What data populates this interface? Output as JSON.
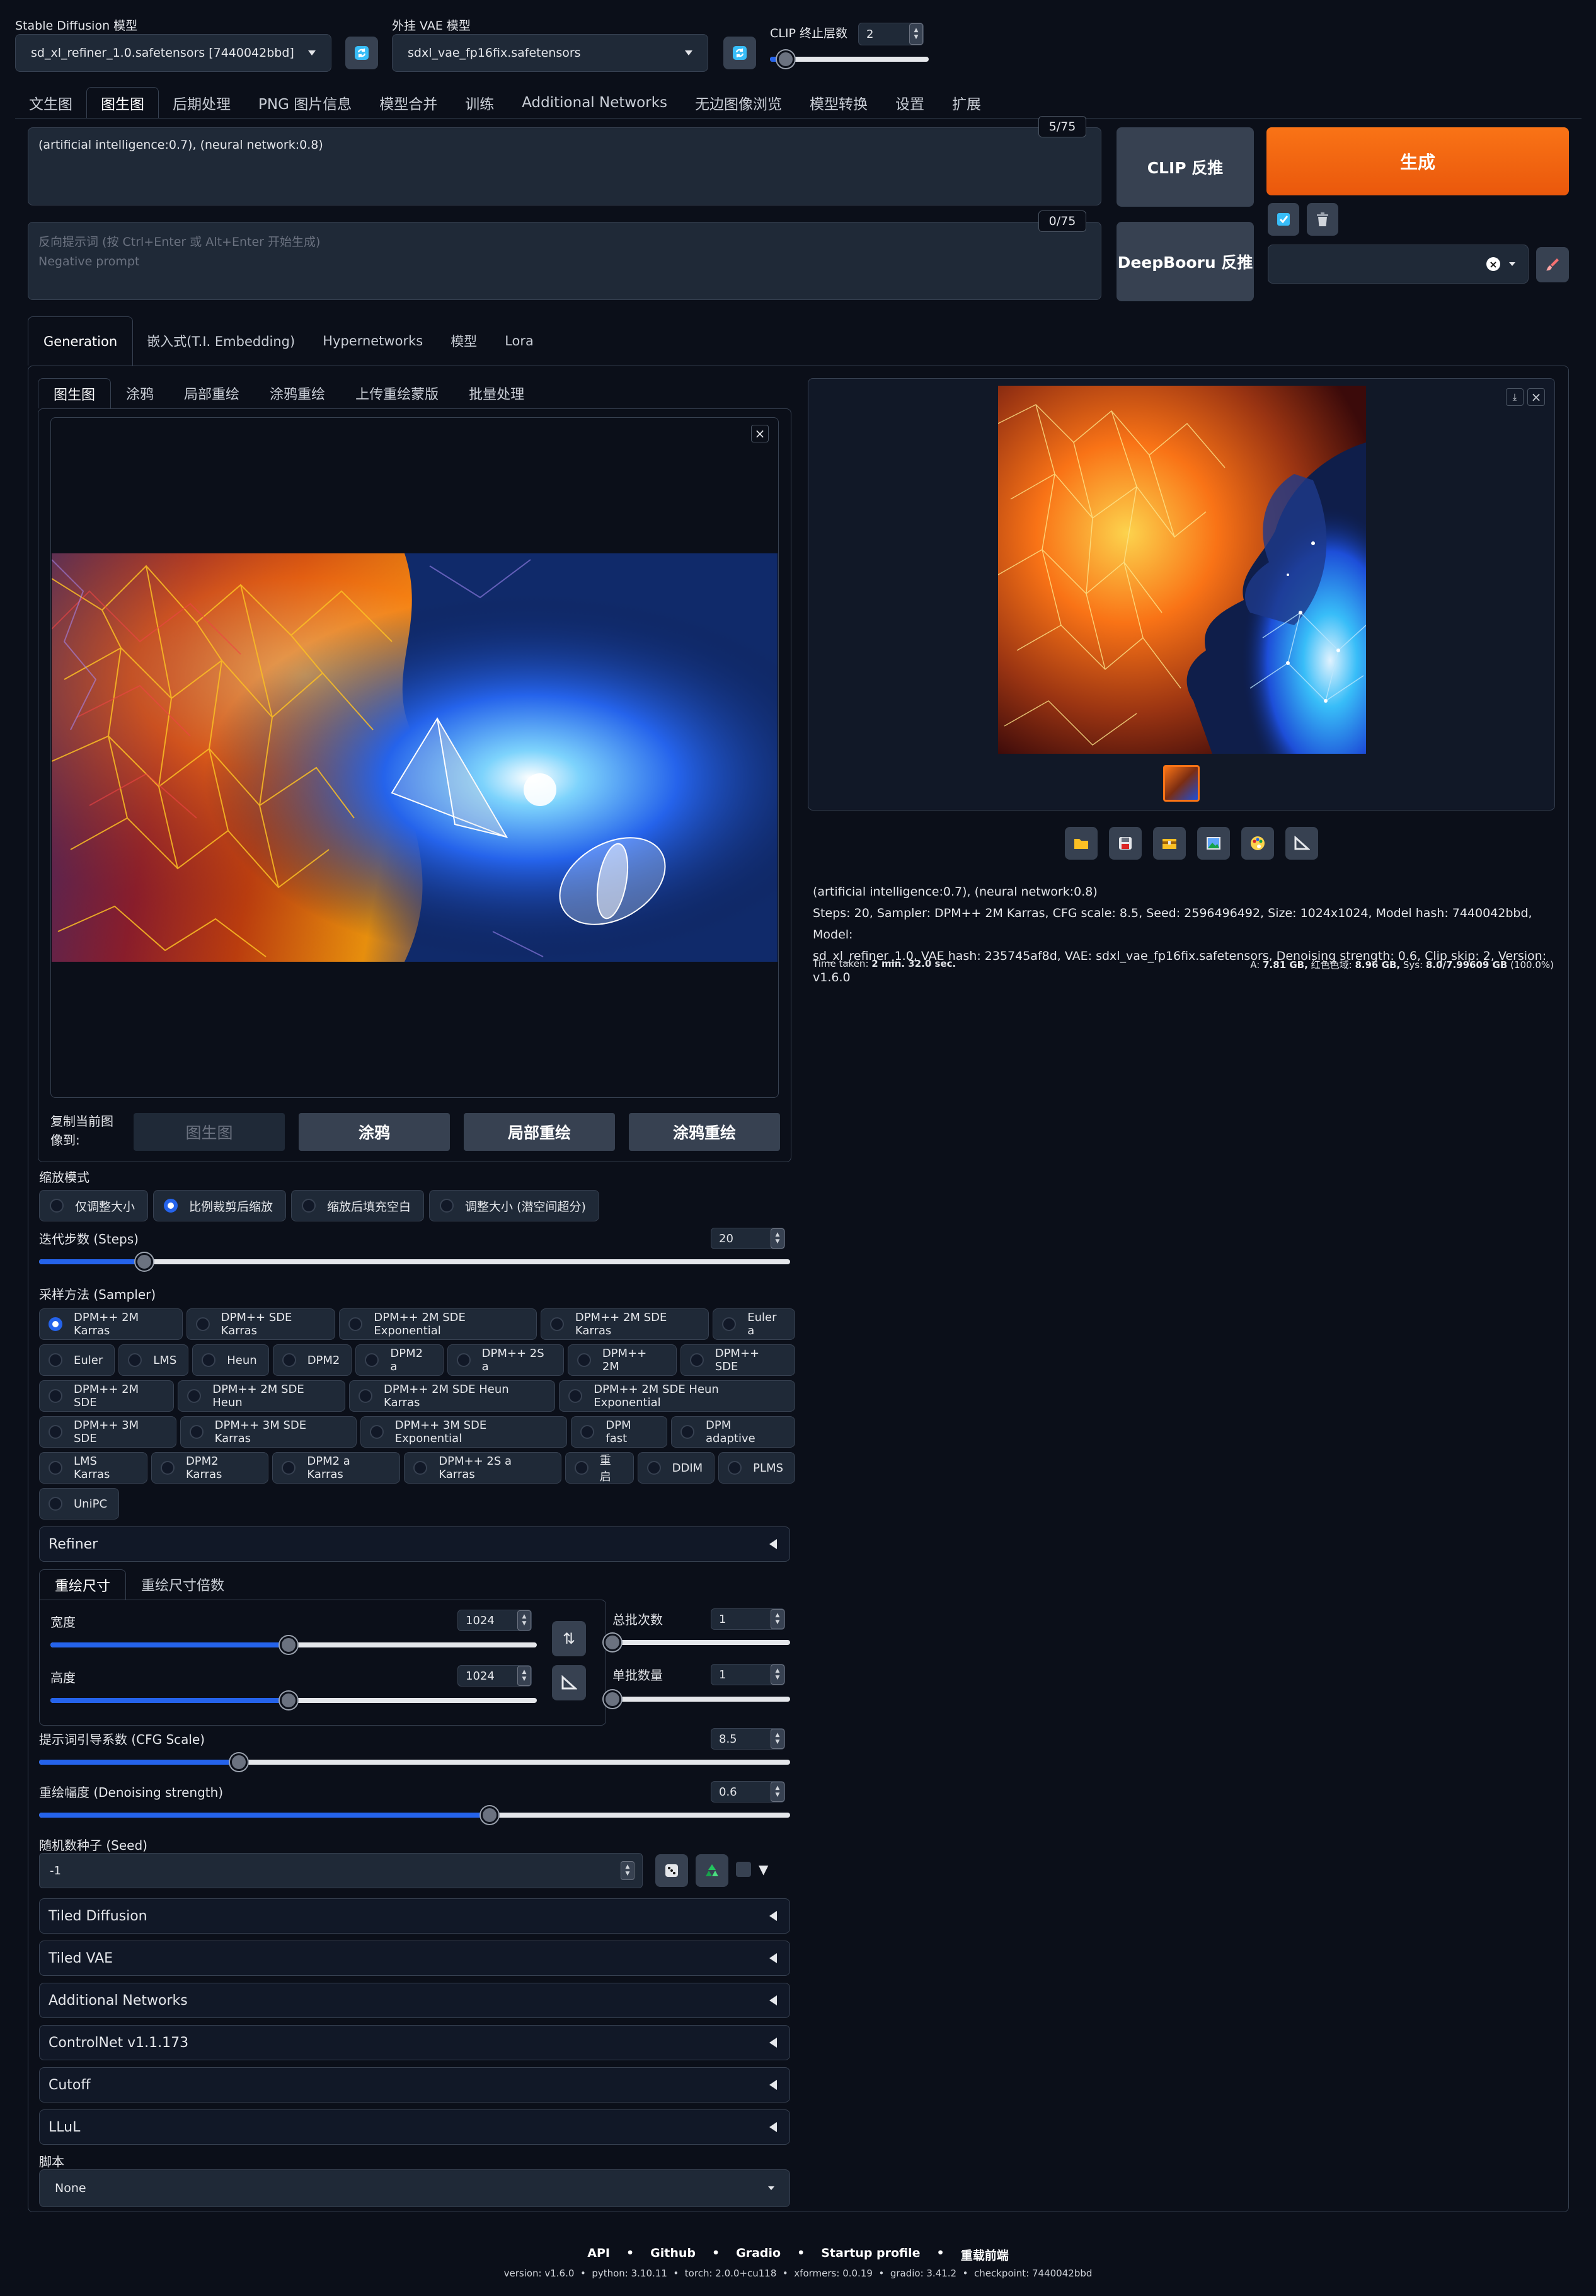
{
  "top": {
    "model_label": "Stable Diffusion 模型",
    "model_value": "sd_xl_refiner_1.0.safetensors [7440042bbd]",
    "vae_label": "外挂 VAE 模型",
    "vae_value": "sdxl_vae_fp16fix.safetensors",
    "clip_label": "CLIP 终止层数",
    "clip_value": "2",
    "clip_slider_fraction": 0.1
  },
  "main_tabs": [
    "文生图",
    "图生图",
    "后期处理",
    "PNG 图片信息",
    "模型合并",
    "训练",
    "Additional Networks",
    "无边图像浏览",
    "模型转换",
    "设置",
    "扩展"
  ],
  "prompt": {
    "text": "(artificial intelligence:0.7), (neural network:0.8)",
    "counter": "5/75",
    "neg_placeholder_1": "反向提示词 (按 Ctrl+Enter 或 Alt+Enter 开始生成)",
    "neg_placeholder_2": "Negative prompt",
    "neg_counter": "0/75"
  },
  "buttons": {
    "clip": "CLIP 反推",
    "deepbooru": "DeepBooru 反推",
    "generate": "生成"
  },
  "colors": {
    "accent": "#ea580c",
    "blue": "#2563eb",
    "bg": "#0b0f19"
  },
  "sub_tabs": [
    "Generation",
    "嵌入式(T.I. Embedding)",
    "Hypernetworks",
    "模型",
    "Lora"
  ],
  "img_tabs": [
    "图生图",
    "涂鸦",
    "局部重绘",
    "涂鸦重绘",
    "上传重绘蒙版",
    "批量处理"
  ],
  "copy": {
    "label": "复制当前图像到:",
    "buttons": [
      "图生图",
      "涂鸦",
      "局部重绘",
      "涂鸦重绘"
    ]
  },
  "resize": {
    "label": "缩放模式",
    "options": [
      "仅调整大小",
      "比例裁剪后缩放",
      "缩放后填充空白",
      "调整大小 (潜空间超分)"
    ],
    "selected": 1
  },
  "steps": {
    "label": "迭代步数 (Steps)",
    "value": "20",
    "fraction": 0.14
  },
  "sampler": {
    "label": "采样方法 (Sampler)",
    "rows": [
      [
        "DPM++ 2M Karras",
        "DPM++ SDE Karras",
        "DPM++ 2M SDE Exponential",
        "DPM++ 2M SDE Karras",
        "Euler a"
      ],
      [
        "Euler",
        "LMS",
        "Heun",
        "DPM2",
        "DPM2 a",
        "DPM++ 2S a",
        "DPM++ 2M",
        "DPM++ SDE"
      ],
      [
        "DPM++ 2M SDE",
        "DPM++ 2M SDE Heun",
        "DPM++ 2M SDE Heun Karras",
        "DPM++ 2M SDE Heun Exponential"
      ],
      [
        "DPM++ 3M SDE",
        "DPM++ 3M SDE Karras",
        "DPM++ 3M SDE Exponential",
        "DPM fast",
        "DPM adaptive"
      ],
      [
        "LMS Karras",
        "DPM2 Karras",
        "DPM2 a Karras",
        "DPM++ 2S a Karras",
        "重启",
        "DDIM",
        "PLMS"
      ],
      [
        "UniPC"
      ]
    ],
    "selected": "DPM++ 2M Karras"
  },
  "refiner": "Refiner",
  "size_tabs": [
    "重绘尺寸",
    "重绘尺寸倍数"
  ],
  "width": {
    "label": "宽度",
    "value": "1024",
    "fraction": 0.49
  },
  "height": {
    "label": "高度",
    "value": "1024",
    "fraction": 0.49
  },
  "batch_count": {
    "label": "总批次数",
    "value": "1",
    "fraction": 0.0
  },
  "batch_size": {
    "label": "单批数量",
    "value": "1",
    "fraction": 0.0
  },
  "cfg": {
    "label": "提示词引导系数 (CFG Scale)",
    "value": "8.5",
    "fraction": 0.266
  },
  "denoise": {
    "label": "重绘幅度 (Denoising strength)",
    "value": "0.6",
    "fraction": 0.6
  },
  "seed": {
    "label": "随机数种子 (Seed)",
    "value": "-1"
  },
  "accordions": [
    "Tiled Diffusion",
    "Tiled VAE",
    "Additional Networks",
    "ControlNet v1.1.173",
    "Cutoff",
    "LLuL"
  ],
  "script": {
    "label": "脚本",
    "value": "None"
  },
  "output": {
    "info_line1": "(artificial intelligence:0.7), (neural network:0.8)",
    "info_line2": "Steps: 20, Sampler: DPM++ 2M Karras, CFG scale: 8.5, Seed: 2596496492, Size: 1024x1024, Model hash: 7440042bbd, Model:",
    "info_line3": "sd_xl_refiner_1.0, VAE hash: 235745af8d, VAE: sdxl_vae_fp16fix.safetensors, Denoising strength: 0.6, Clip skip: 2, Version: v1.6.0",
    "time_label": "Time taken:",
    "time_value": "2 min. 32.0 sec.",
    "vram_a_label": "A:",
    "vram_a": "7.81 GB,",
    "vram_r_label": "红色色域:",
    "vram_r": "8.96 GB,",
    "vram_s_label": "Sys:",
    "vram_s": "8.0/7.99609 GB",
    "vram_pct": "(100.0%)"
  },
  "footer": {
    "links": [
      "API",
      "Github",
      "Gradio",
      "Startup profile",
      "重载前端"
    ],
    "version_line": "version: v1.6.0  •  python: 3.10.11  •  torch: 2.0.0+cu118  •  xformers: 0.0.19  •  gradio: 3.41.2  •  checkpoint: 7440042bbd"
  }
}
